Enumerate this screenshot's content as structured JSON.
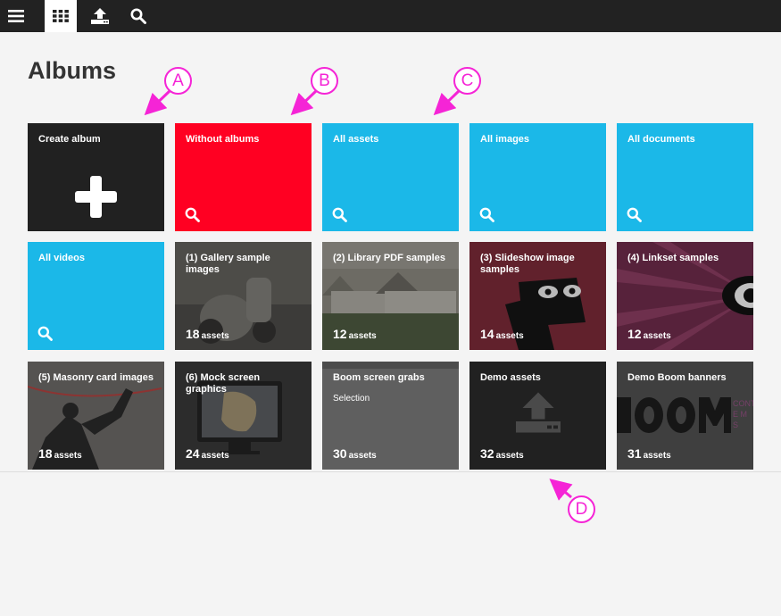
{
  "toolbar": {
    "buttons": [
      {
        "icon": "menu-icon"
      },
      {
        "icon": "grid-icon",
        "active": true
      },
      {
        "icon": "upload-icon"
      },
      {
        "icon": "search-icon"
      }
    ]
  },
  "page": {
    "title": "Albums"
  },
  "tiles": [
    {
      "title": "Create album"
    },
    {
      "title": "Without albums"
    },
    {
      "title": "All assets"
    },
    {
      "title": "All images"
    },
    {
      "title": "All documents"
    },
    {
      "title": "All videos"
    },
    {
      "title": "(1) Gallery sample images",
      "count": "18",
      "unit": "assets"
    },
    {
      "title": "(2) Library PDF samples",
      "count": "12",
      "unit": "assets"
    },
    {
      "title": "(3) Slideshow image samples",
      "count": "14",
      "unit": "assets"
    },
    {
      "title": "(4) Linkset samples",
      "count": "12",
      "unit": "assets"
    },
    {
      "title": "(5) Masonry card images",
      "count": "18",
      "unit": "assets"
    },
    {
      "title": "(6) Mock screen graphics",
      "count": "24",
      "unit": "assets"
    },
    {
      "title": "Boom screen grabs",
      "subtitle": "Selection",
      "count": "30",
      "unit": "assets"
    },
    {
      "title": "Demo assets",
      "count": "32",
      "unit": "assets"
    },
    {
      "title": "Demo Boom banners",
      "count": "31",
      "unit": "assets"
    }
  ],
  "callouts": [
    "A",
    "B",
    "C",
    "D"
  ],
  "colors": {
    "black_tile": "#212121",
    "red_tile": "#ff0022",
    "blue_tile": "#1bb8e8",
    "callout": "#f524d6",
    "toolbar": "#222222"
  }
}
